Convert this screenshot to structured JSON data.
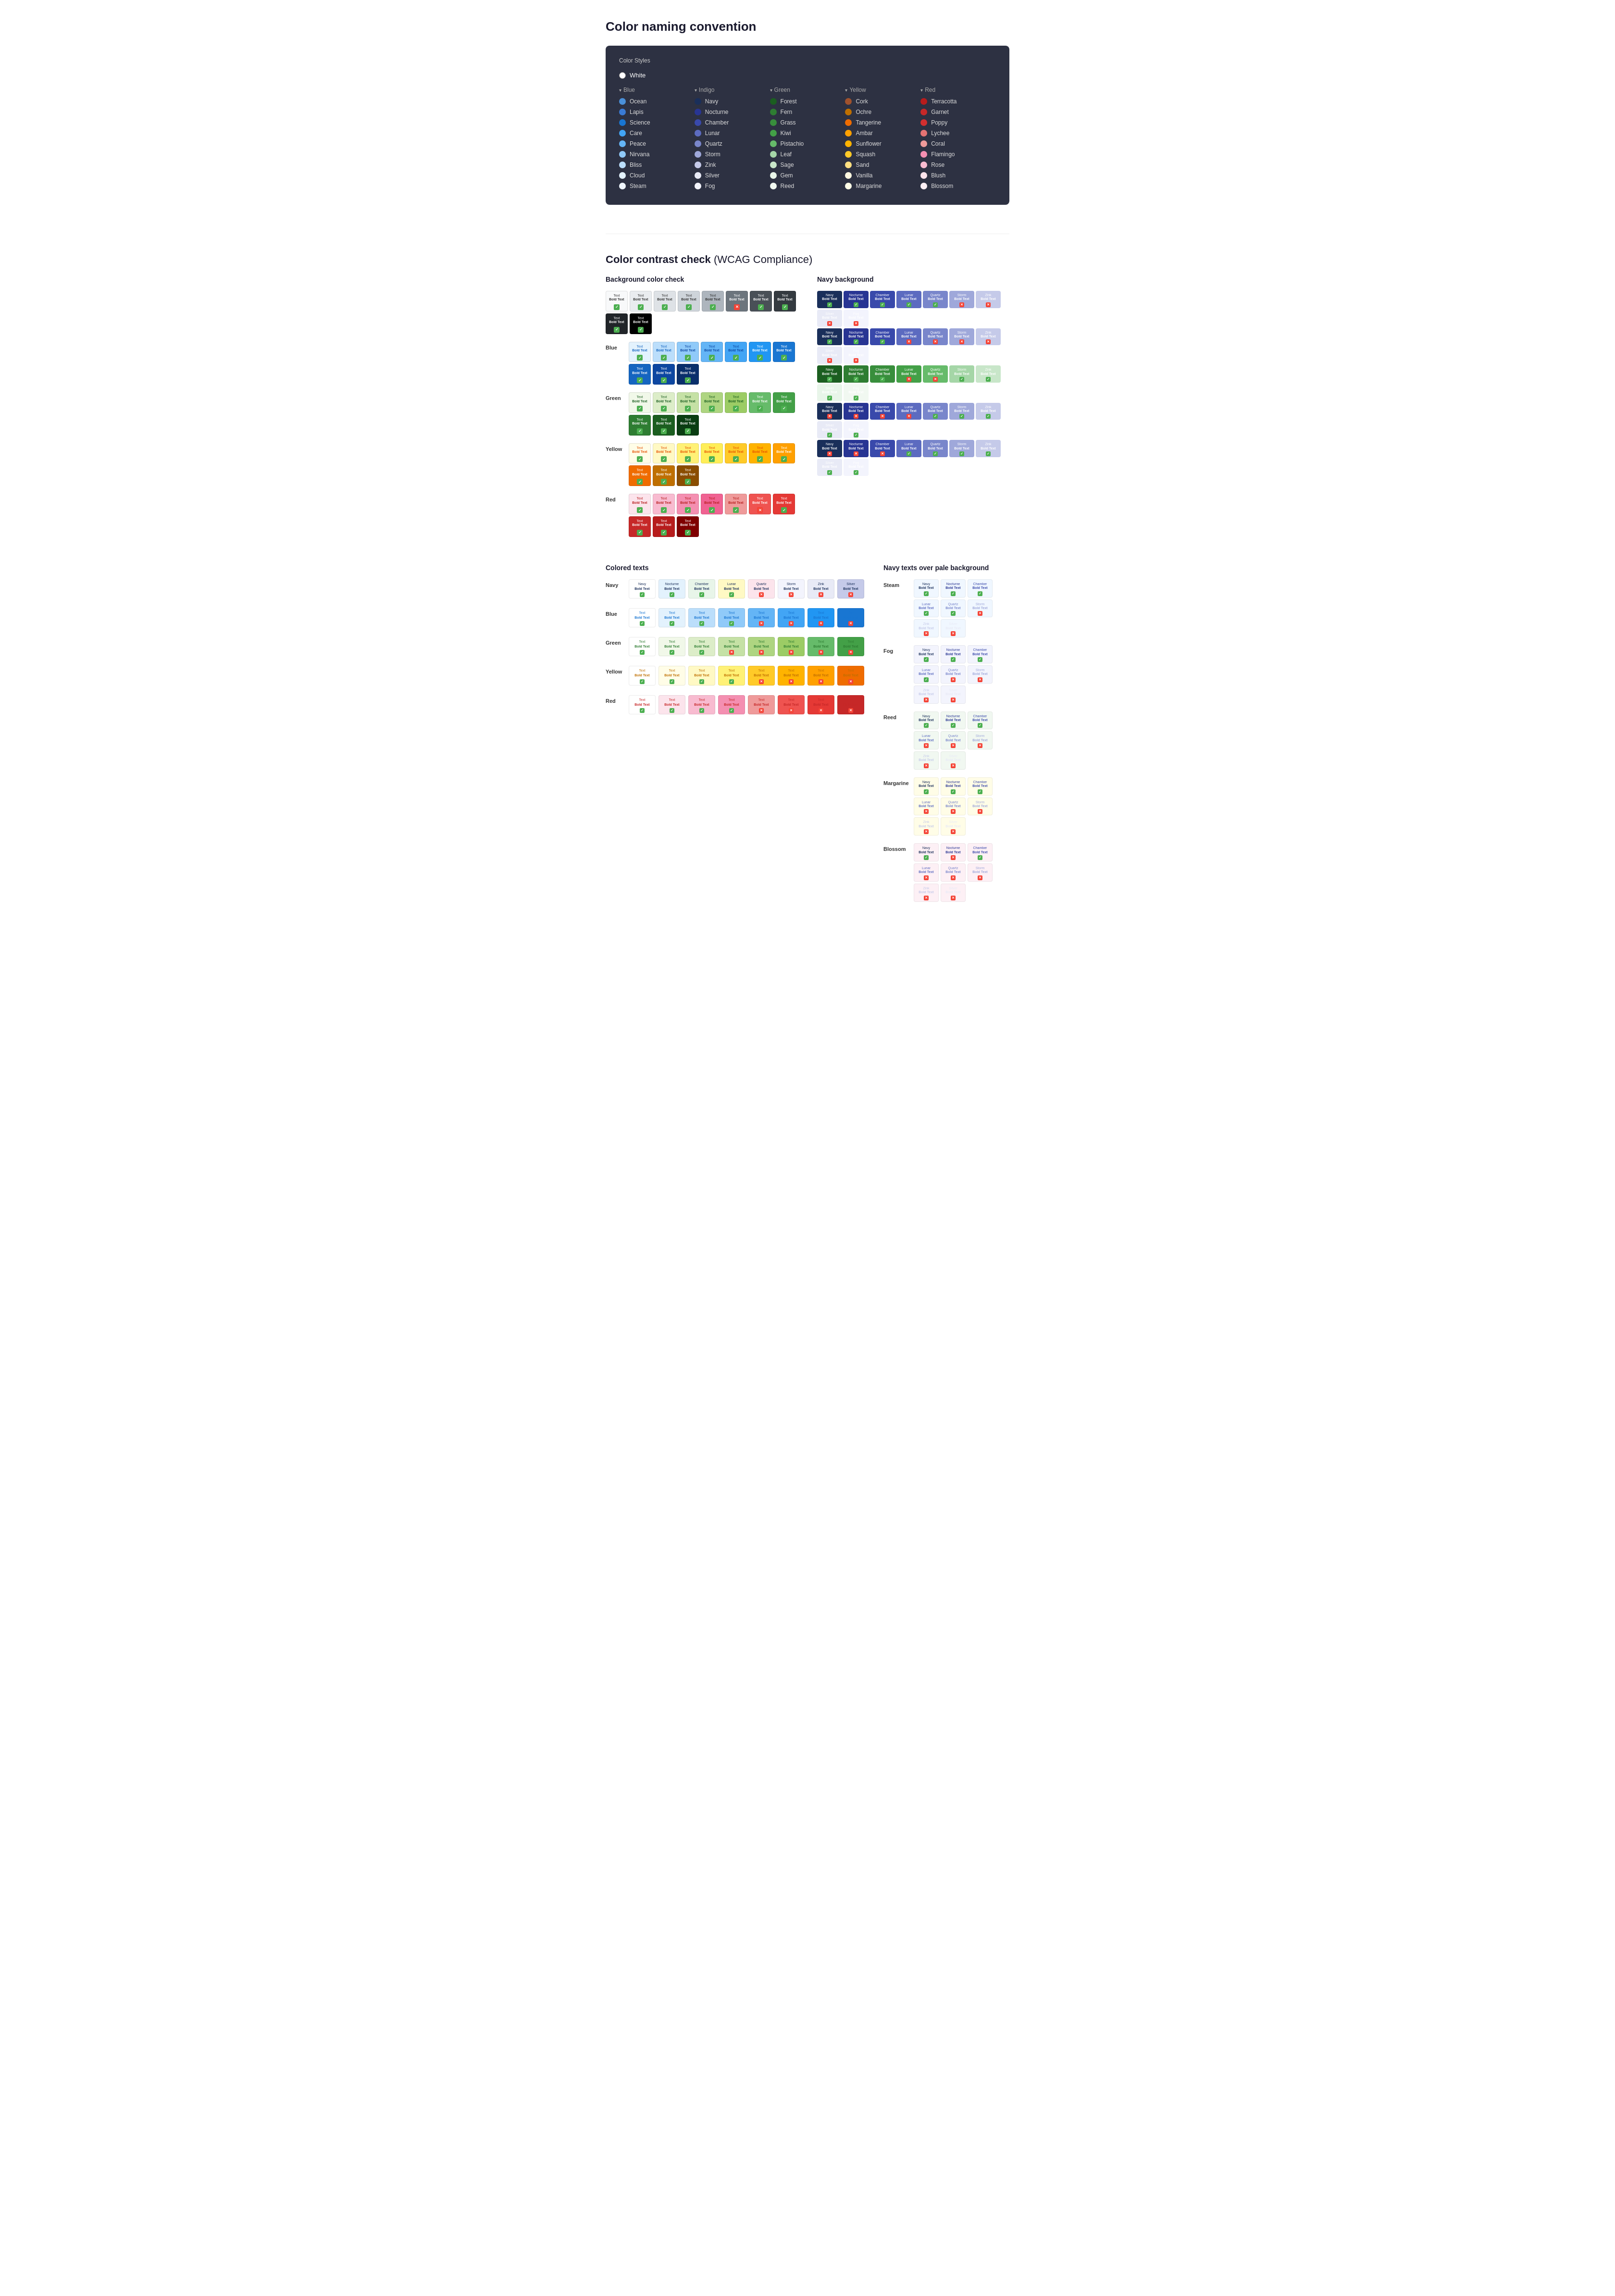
{
  "page": {
    "title1": "Color naming convention",
    "title2": "Color contrast check",
    "title2_sub": "(WCAG Compliance)"
  },
  "colorPanel": {
    "panelTitle": "Color Styles",
    "whiteLabel": "White",
    "groups": [
      {
        "name": "Blue",
        "items": [
          {
            "label": "Ocean",
            "color": "#4a90d9"
          },
          {
            "label": "Lapis",
            "color": "#3a7bd5"
          },
          {
            "label": "Science",
            "color": "#1976d2"
          },
          {
            "label": "Care",
            "color": "#42a5f5"
          },
          {
            "label": "Peace",
            "color": "#64b5f6"
          },
          {
            "label": "Nirvana",
            "color": "#90caf9"
          },
          {
            "label": "Bliss",
            "color": "#bbdefb"
          },
          {
            "label": "Cloud",
            "color": "#e3f2fd"
          },
          {
            "label": "Steam",
            "color": "#f0f7ff"
          }
        ]
      },
      {
        "name": "Indigo",
        "items": [
          {
            "label": "Navy",
            "color": "#1a2f5a"
          },
          {
            "label": "Nocturne",
            "color": "#283593"
          },
          {
            "label": "Chamber",
            "color": "#3949ab"
          },
          {
            "label": "Lunar",
            "color": "#5c6bc0"
          },
          {
            "label": "Quartz",
            "color": "#7986cb"
          },
          {
            "label": "Storm",
            "color": "#9fa8da"
          },
          {
            "label": "Zink",
            "color": "#c5cae9"
          },
          {
            "label": "Silver",
            "color": "#e8eaf6"
          },
          {
            "label": "Fog",
            "color": "#f3f4fd"
          }
        ]
      },
      {
        "name": "Green",
        "items": [
          {
            "label": "Forest",
            "color": "#1b5e20"
          },
          {
            "label": "Fern",
            "color": "#2e7d32"
          },
          {
            "label": "Grass",
            "color": "#388e3c"
          },
          {
            "label": "Kiwi",
            "color": "#43a047"
          },
          {
            "label": "Pistachio",
            "color": "#66bb6a"
          },
          {
            "label": "Leaf",
            "color": "#a5d6a7"
          },
          {
            "label": "Sage",
            "color": "#c8e6c9"
          },
          {
            "label": "Gem",
            "color": "#e8f5e9"
          },
          {
            "label": "Reed",
            "color": "#f1f8f1"
          }
        ]
      },
      {
        "name": "Yellow",
        "items": [
          {
            "label": "Cork",
            "color": "#a0522d"
          },
          {
            "label": "Ochre",
            "color": "#bf6f00"
          },
          {
            "label": "Tangerine",
            "color": "#ef6c00"
          },
          {
            "label": "Ambar",
            "color": "#ffa000"
          },
          {
            "label": "Sunflower",
            "color": "#ffb300"
          },
          {
            "label": "Squash",
            "color": "#ffca28"
          },
          {
            "label": "Sand",
            "color": "#ffe082"
          },
          {
            "label": "Vanilla",
            "color": "#fff8e1"
          },
          {
            "label": "Margarine",
            "color": "#fffde7"
          }
        ]
      },
      {
        "name": "Red",
        "items": [
          {
            "label": "Terracotta",
            "color": "#b71c1c"
          },
          {
            "label": "Garnet",
            "color": "#c62828"
          },
          {
            "label": "Poppy",
            "color": "#d32f2f"
          },
          {
            "label": "Lychee",
            "color": "#e57373"
          },
          {
            "label": "Coral",
            "color": "#ef9a9a"
          },
          {
            "label": "Flamingo",
            "color": "#f48fb1"
          },
          {
            "label": "Rose",
            "color": "#f8bbd0"
          },
          {
            "label": "Blush",
            "color": "#fce4ec"
          },
          {
            "label": "Blossom",
            "color": "#fdf0f5"
          }
        ]
      }
    ]
  },
  "contrastSection": {
    "bgColorCheck": "Background color check",
    "navyBg": "Navy background",
    "coloredTexts": "Colored texts",
    "navyTexts": "Navy texts over pale background"
  },
  "bgRows": [
    {
      "label": "",
      "cells": [
        {
          "bg": "#f8f9fa",
          "text": "#333",
          "pass": true
        },
        {
          "bg": "#e9ecef",
          "text": "#333",
          "pass": true
        },
        {
          "bg": "#dee2e6",
          "text": "#333",
          "pass": true
        },
        {
          "bg": "#ced4da",
          "text": "#333",
          "pass": true
        },
        {
          "bg": "#adb5bd",
          "text": "#333",
          "pass": true
        },
        {
          "bg": "#6c757d",
          "text": "#fff",
          "pass": false
        },
        {
          "bg": "#495057",
          "text": "#fff",
          "pass": true
        },
        {
          "bg": "#343a40",
          "text": "#fff",
          "pass": true
        },
        {
          "bg": "#212529",
          "text": "#fff",
          "pass": true
        },
        {
          "bg": "#000000",
          "text": "#fff",
          "pass": true,
          "bold": true
        }
      ]
    }
  ],
  "navyBgRows": [
    {
      "cells": [
        {
          "bg": "#1a2f5a",
          "label": "Navy"
        },
        {
          "bg": "#283593",
          "label": "Nocturne"
        },
        {
          "bg": "#3949ab",
          "label": "Chamber"
        },
        {
          "bg": "#5c6bc0",
          "label": "Lunar"
        },
        {
          "bg": "#7986cb",
          "label": "Quartz"
        },
        {
          "bg": "#9fa8da",
          "label": "Storm"
        },
        {
          "bg": "#c5cae9",
          "label": "Zink"
        },
        {
          "bg": "#e8eaf6",
          "label": "Silver"
        },
        {
          "bg": "#f3f4fd",
          "label": "Fog"
        }
      ]
    }
  ],
  "coloredTextRows": [
    {
      "group": "Navy",
      "textColor": "#1a2f5a",
      "cells": [
        {
          "bg": "#fff",
          "label": "Navy",
          "pass": true
        },
        {
          "bg": "#fff",
          "label": "Nocturne",
          "pass": true
        },
        {
          "bg": "#fff",
          "label": "Chamber",
          "pass": true
        },
        {
          "bg": "#fff",
          "label": "Lunar",
          "pass": true
        },
        {
          "bg": "#fff",
          "label": "Quartz",
          "pass": false
        },
        {
          "bg": "#fff",
          "label": "Storm",
          "pass": false
        },
        {
          "bg": "#fff",
          "label": "Zink",
          "pass": false
        },
        {
          "bg": "#fff",
          "label": "Silver",
          "pass": false
        }
      ]
    },
    {
      "group": "Blue",
      "textColor": "#1976d2",
      "cells": [
        {
          "bg": "#fff",
          "label": "Text",
          "pass": true
        },
        {
          "bg": "#fff",
          "label": "Text",
          "pass": true
        },
        {
          "bg": "#fff",
          "label": "Text",
          "pass": true
        },
        {
          "bg": "#fff",
          "label": "Text",
          "pass": true
        },
        {
          "bg": "#fff",
          "label": "Text",
          "pass": true
        },
        {
          "bg": "#fff",
          "label": "Text",
          "pass": false
        },
        {
          "bg": "#fff",
          "label": "Text",
          "pass": false
        },
        {
          "bg": "#fff",
          "label": "Text",
          "pass": false
        }
      ]
    },
    {
      "group": "Green",
      "textColor": "#2e7d32",
      "cells": [
        {
          "bg": "#fff",
          "label": "Text",
          "pass": true
        },
        {
          "bg": "#fff",
          "label": "Text",
          "pass": true
        },
        {
          "bg": "#fff",
          "label": "Text",
          "pass": true
        },
        {
          "bg": "#fff",
          "label": "Text",
          "pass": false
        },
        {
          "bg": "#fff",
          "label": "Text",
          "pass": false
        },
        {
          "bg": "#fff",
          "label": "Text",
          "pass": false
        },
        {
          "bg": "#fff",
          "label": "Text",
          "pass": false
        },
        {
          "bg": "#fff",
          "label": "Text",
          "pass": false
        }
      ]
    },
    {
      "group": "Yellow",
      "textColor": "#e65100",
      "cells": [
        {
          "bg": "#fff",
          "label": "Text",
          "pass": true
        },
        {
          "bg": "#fff",
          "label": "Text",
          "pass": true
        },
        {
          "bg": "#fff",
          "label": "Text",
          "pass": true
        },
        {
          "bg": "#fff",
          "label": "Text",
          "pass": true
        },
        {
          "bg": "#fff",
          "label": "Text",
          "pass": false
        },
        {
          "bg": "#fff",
          "label": "Text",
          "pass": false
        },
        {
          "bg": "#fff",
          "label": "Text",
          "pass": false
        },
        {
          "bg": "#fff",
          "label": "Text",
          "pass": false
        }
      ]
    },
    {
      "group": "Red",
      "textColor": "#c62828",
      "cells": [
        {
          "bg": "#fff",
          "label": "Text",
          "pass": true
        },
        {
          "bg": "#fff",
          "label": "Text",
          "pass": true
        },
        {
          "bg": "#fff",
          "label": "Text",
          "pass": true
        },
        {
          "bg": "#fff",
          "label": "Text",
          "pass": true
        },
        {
          "bg": "#fff",
          "label": "Text",
          "pass": false
        },
        {
          "bg": "#fff",
          "label": "Text",
          "pass": false
        },
        {
          "bg": "#fff",
          "label": "Text",
          "pass": false
        },
        {
          "bg": "#fff",
          "label": "Text",
          "pass": false
        }
      ]
    }
  ],
  "navyTextsPaleRows": [
    {
      "group": "Steam",
      "cells": [
        {
          "label": "Navy",
          "pass": true
        },
        {
          "label": "Nocturne",
          "pass": true
        },
        {
          "label": "Chamber",
          "pass": true
        },
        {
          "label": "Lunar",
          "pass": true
        },
        {
          "label": "Quartz",
          "pass": true
        },
        {
          "label": "Storm",
          "pass": false
        },
        {
          "label": "Zink",
          "pass": false
        },
        {
          "label": "Silver",
          "pass": false
        }
      ]
    },
    {
      "group": "Fog",
      "cells": [
        {
          "label": "Navy",
          "pass": true
        },
        {
          "label": "Nocturne",
          "pass": true
        },
        {
          "label": "Chamber",
          "pass": true
        },
        {
          "label": "Lunar",
          "pass": true
        },
        {
          "label": "Quartz",
          "pass": false
        },
        {
          "label": "Storm",
          "pass": false
        },
        {
          "label": "Zink",
          "pass": false
        },
        {
          "label": "Silver",
          "pass": false
        }
      ]
    },
    {
      "group": "Reed",
      "cells": [
        {
          "label": "Navy",
          "pass": true
        },
        {
          "label": "Nocturne",
          "pass": true
        },
        {
          "label": "Chamber",
          "pass": true
        },
        {
          "label": "Lunar",
          "pass": false
        },
        {
          "label": "Quartz",
          "pass": false
        },
        {
          "label": "Storm",
          "pass": false
        },
        {
          "label": "Zink",
          "pass": false
        },
        {
          "label": "Silver",
          "pass": false
        }
      ]
    },
    {
      "group": "Margarine",
      "cells": [
        {
          "label": "Navy",
          "pass": true
        },
        {
          "label": "Nocturne",
          "pass": true
        },
        {
          "label": "Chamber",
          "pass": true
        },
        {
          "label": "Lunar",
          "pass": false
        },
        {
          "label": "Quartz",
          "pass": false
        },
        {
          "label": "Storm",
          "pass": false
        },
        {
          "label": "Zink",
          "pass": false
        },
        {
          "label": "Silver",
          "pass": false
        }
      ]
    },
    {
      "group": "Blossom",
      "cells": [
        {
          "label": "Navy",
          "pass": true
        },
        {
          "label": "Nocturne",
          "pass": false
        },
        {
          "label": "Chamber",
          "pass": true
        },
        {
          "label": "Lunar",
          "pass": false
        },
        {
          "label": "Quartz",
          "pass": false
        },
        {
          "label": "Storm",
          "pass": false
        },
        {
          "label": "Zink",
          "pass": false
        },
        {
          "label": "Silver",
          "pass": false
        }
      ]
    }
  ]
}
